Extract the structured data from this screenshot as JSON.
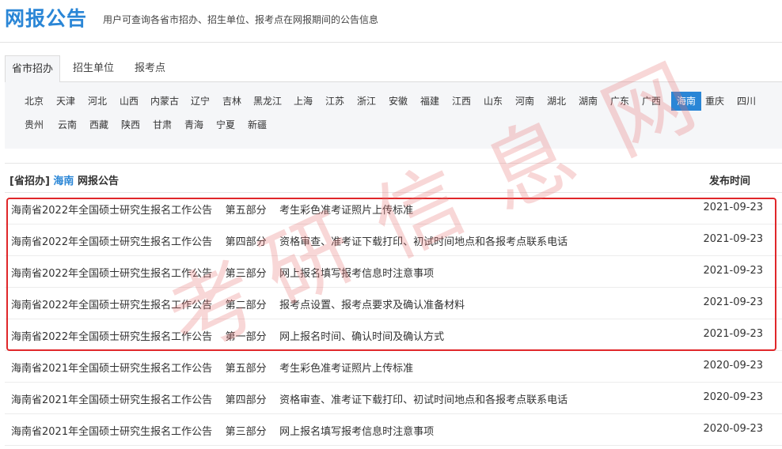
{
  "header": {
    "title": "网报公告",
    "subtitle": "用户可查询各省市招办、招生单位、报考点在网报期间的公告信息"
  },
  "tabs": [
    {
      "label": "省市招办",
      "active": true
    },
    {
      "label": "招生单位",
      "active": false
    },
    {
      "label": "报考点",
      "active": false
    }
  ],
  "regions": [
    "北京",
    "天津",
    "河北",
    "山西",
    "内蒙古",
    "辽宁",
    "吉林",
    "黑龙江",
    "上海",
    "江苏",
    "浙江",
    "安徽",
    "福建",
    "江西",
    "山东",
    "河南",
    "湖北",
    "湖南",
    "广东",
    "广西",
    "海南",
    "重庆",
    "四川",
    "贵州",
    "云南",
    "西藏",
    "陕西",
    "甘肃",
    "青海",
    "宁夏",
    "新疆"
  ],
  "selected_region": "海南",
  "table": {
    "head_prefix": "[省招办]",
    "head_region": "海南",
    "head_suffix": "网报公告",
    "date_header": "发布时间",
    "rows": [
      {
        "title": "海南省2022年全国硕士研究生报名工作公告    第五部分    考生彩色准考证照片上传标准",
        "date": "2021-09-23"
      },
      {
        "title": "海南省2022年全国硕士研究生报名工作公告    第四部分    资格审查、准考证下载打印、初试时间地点和各报考点联系电话",
        "date": "2021-09-23"
      },
      {
        "title": "海南省2022年全国硕士研究生报名工作公告    第三部分    网上报名填写报考信息时注意事项",
        "date": "2021-09-23"
      },
      {
        "title": "海南省2022年全国硕士研究生报名工作公告    第二部分    报考点设置、报考点要求及确认准备材料",
        "date": "2021-09-23"
      },
      {
        "title": "海南省2022年全国硕士研究生报名工作公告    第一部分    网上报名时间、确认时间及确认方式",
        "date": "2021-09-23"
      },
      {
        "title": "海南省2021年全国硕士研究生报名工作公告    第五部分    考生彩色准考证照片上传标准",
        "date": "2020-09-23"
      },
      {
        "title": "海南省2021年全国硕士研究生报名工作公告    第四部分    资格审查、准考证下载打印、初试时间地点和各报考点联系电话",
        "date": "2020-09-23"
      },
      {
        "title": "海南省2021年全国硕士研究生报名工作公告    第三部分    网上报名填写报考信息时注意事项",
        "date": "2020-09-23"
      }
    ]
  },
  "watermark": [
    "考",
    "研",
    "信",
    "息",
    "网"
  ],
  "colors": {
    "accent": "#2a86d6",
    "highlight": "#e0272a"
  }
}
